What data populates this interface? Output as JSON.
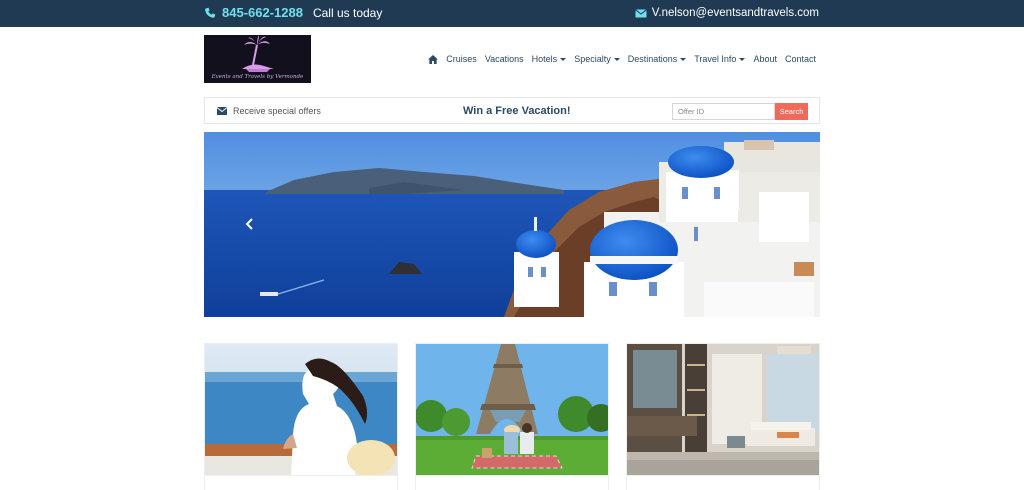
{
  "topbar": {
    "phone": "845-662-1288",
    "call_text": "Call us today",
    "email": "V.nelson@eventsandtravels.com"
  },
  "logo": {
    "tagline": "Events and Travels by Vermonde"
  },
  "nav": {
    "items": [
      {
        "label": "Cruises",
        "dropdown": false
      },
      {
        "label": "Vacations",
        "dropdown": false
      },
      {
        "label": "Hotels",
        "dropdown": true
      },
      {
        "label": "Specialty",
        "dropdown": true
      },
      {
        "label": "Destinations",
        "dropdown": true
      },
      {
        "label": "Travel Info",
        "dropdown": true
      },
      {
        "label": "About",
        "dropdown": false
      },
      {
        "label": "Contact",
        "dropdown": false
      }
    ]
  },
  "offers": {
    "receive_text": "Receive special offers",
    "headline": "Win a Free Vacation!",
    "input_placeholder": "Offer ID",
    "search_label": "Search"
  },
  "cards": [
    {
      "image": "woman-on-cruise-deck"
    },
    {
      "image": "couple-at-eiffel-tower"
    },
    {
      "image": "luxury-hotel-room"
    }
  ],
  "colors": {
    "topbar_bg": "#1f3a52",
    "accent_phone": "#6fe0f0",
    "nav_text": "#2b4a63",
    "search_button": "#f06a5b"
  }
}
